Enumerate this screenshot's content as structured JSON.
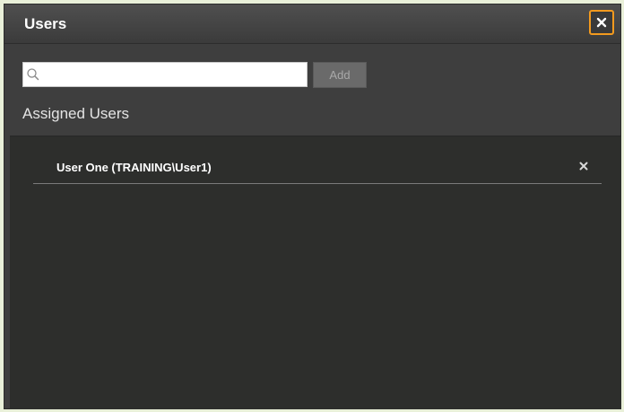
{
  "dialog": {
    "title": "Users",
    "close_icon": "close-icon",
    "close_highlight_color": "#f39a1e"
  },
  "search": {
    "value": "",
    "placeholder": "",
    "icon": "search-icon"
  },
  "add_button": {
    "label": "Add"
  },
  "assigned": {
    "label": "Assigned Users",
    "items": [
      {
        "name": "User One (TRAINING\\User1)",
        "remove_icon": "close-icon"
      }
    ]
  }
}
